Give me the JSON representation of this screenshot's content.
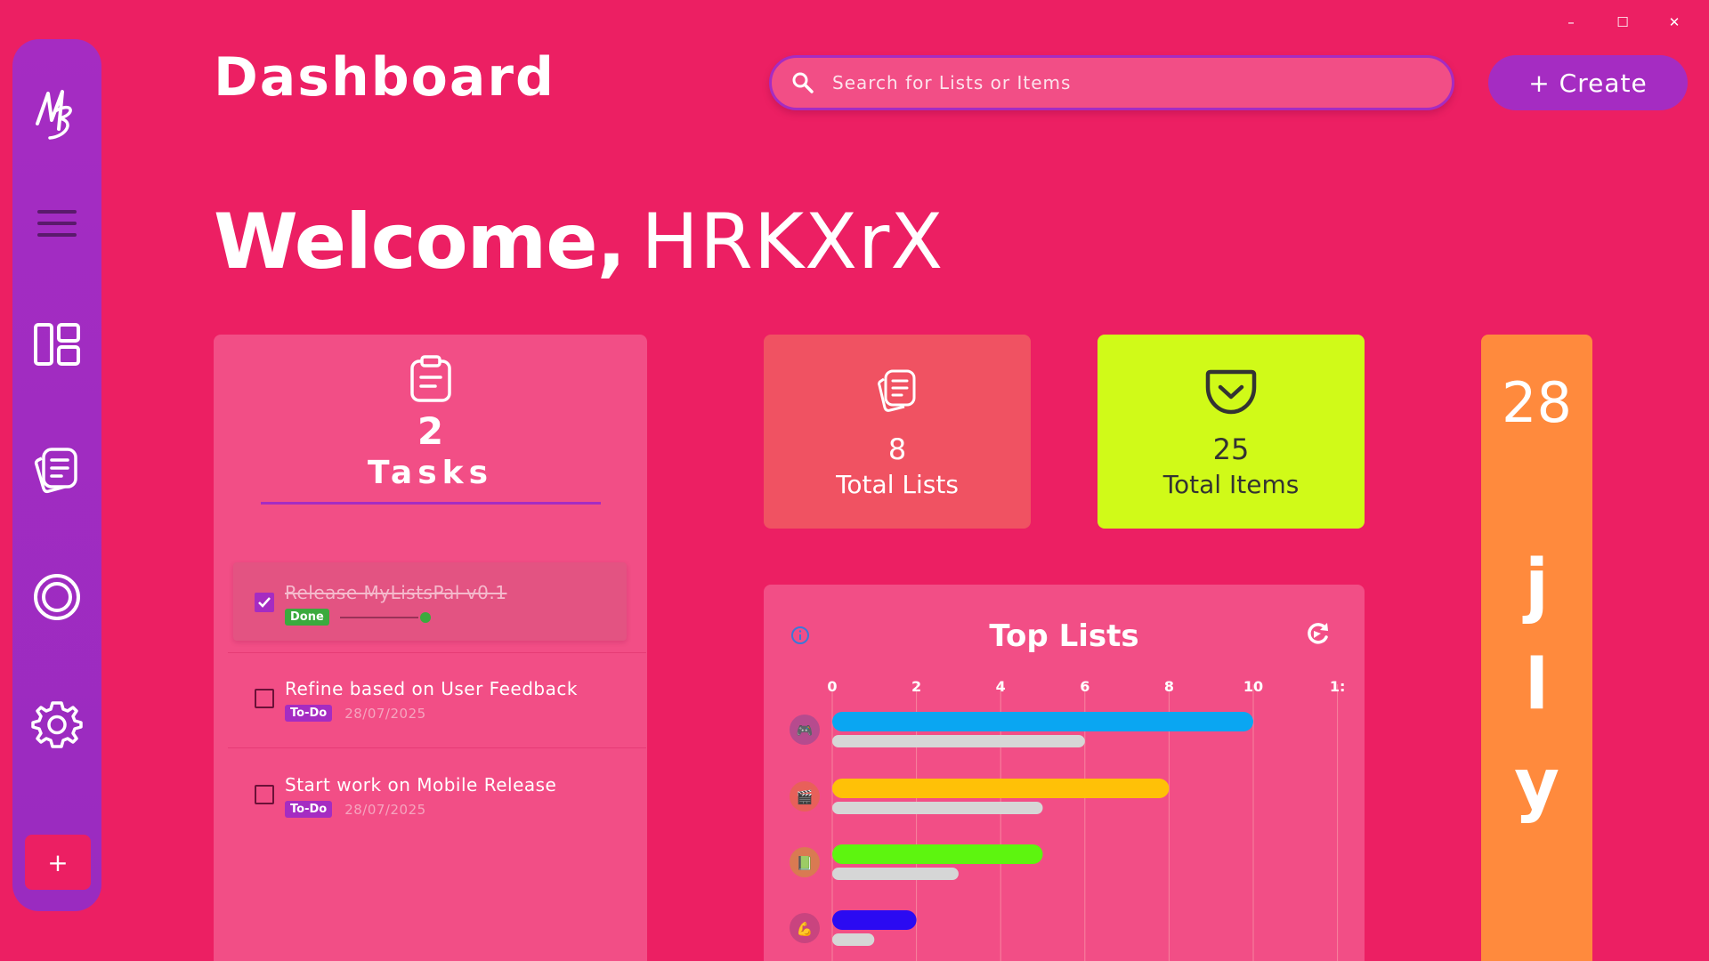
{
  "window": {
    "minimize": "–",
    "maximize": "☐",
    "close": "✕"
  },
  "sidebar": {
    "items": [
      {
        "icon": "menu-icon"
      },
      {
        "icon": "dashboard-icon"
      },
      {
        "icon": "lists-icon"
      },
      {
        "icon": "circle-icon"
      },
      {
        "icon": "settings-icon"
      }
    ],
    "add_label": "+"
  },
  "header": {
    "title": "Dashboard",
    "search_placeholder": "Search for Lists or Items",
    "create_label": "+ Create"
  },
  "welcome": {
    "greeting": "Welcome,",
    "username": "HRKXrX"
  },
  "tasks": {
    "count": "2",
    "label": "Tasks",
    "items": [
      {
        "title": "Release MyListsPal v0.1",
        "status": "Done",
        "date": "",
        "checked": true
      },
      {
        "title": "Refine based on User Feedback",
        "status": "To-Do",
        "date": "28/07/2025",
        "checked": false
      },
      {
        "title": "Start work on Mobile Release",
        "status": "To-Do",
        "date": "28/07/2025",
        "checked": false
      }
    ]
  },
  "stats": {
    "lists": {
      "value": "8",
      "label": "Total Lists"
    },
    "items": {
      "value": "25",
      "label": "Total Items"
    }
  },
  "date_strip": {
    "day": "28",
    "letters": [
      "j",
      "l",
      "y"
    ]
  },
  "colors": {
    "background": "#EC1F63",
    "sidebar": "#A52CC2",
    "card": "#F24E86",
    "lists_card": "#F05262",
    "items_card": "#D0FA18",
    "date_strip": "#FF8A3D"
  },
  "chart_data": {
    "type": "bar",
    "title": "Top Lists",
    "orientation": "horizontal",
    "x_ticks": [
      "0",
      "2",
      "4",
      "6",
      "8",
      "10",
      "1:"
    ],
    "xlim": [
      0,
      12
    ],
    "grid": true,
    "categories": [
      "games-icon",
      "movies-icon",
      "books-icon",
      "fitness-icon"
    ],
    "series": [
      {
        "values": [
          10,
          8,
          5,
          2
        ],
        "colors": [
          "#0AA6F2",
          "#FFC107",
          "#5DF50F",
          "#2B0AF2"
        ]
      },
      {
        "values": [
          6,
          5,
          3,
          1
        ],
        "color": "#D6D6D6"
      }
    ]
  }
}
